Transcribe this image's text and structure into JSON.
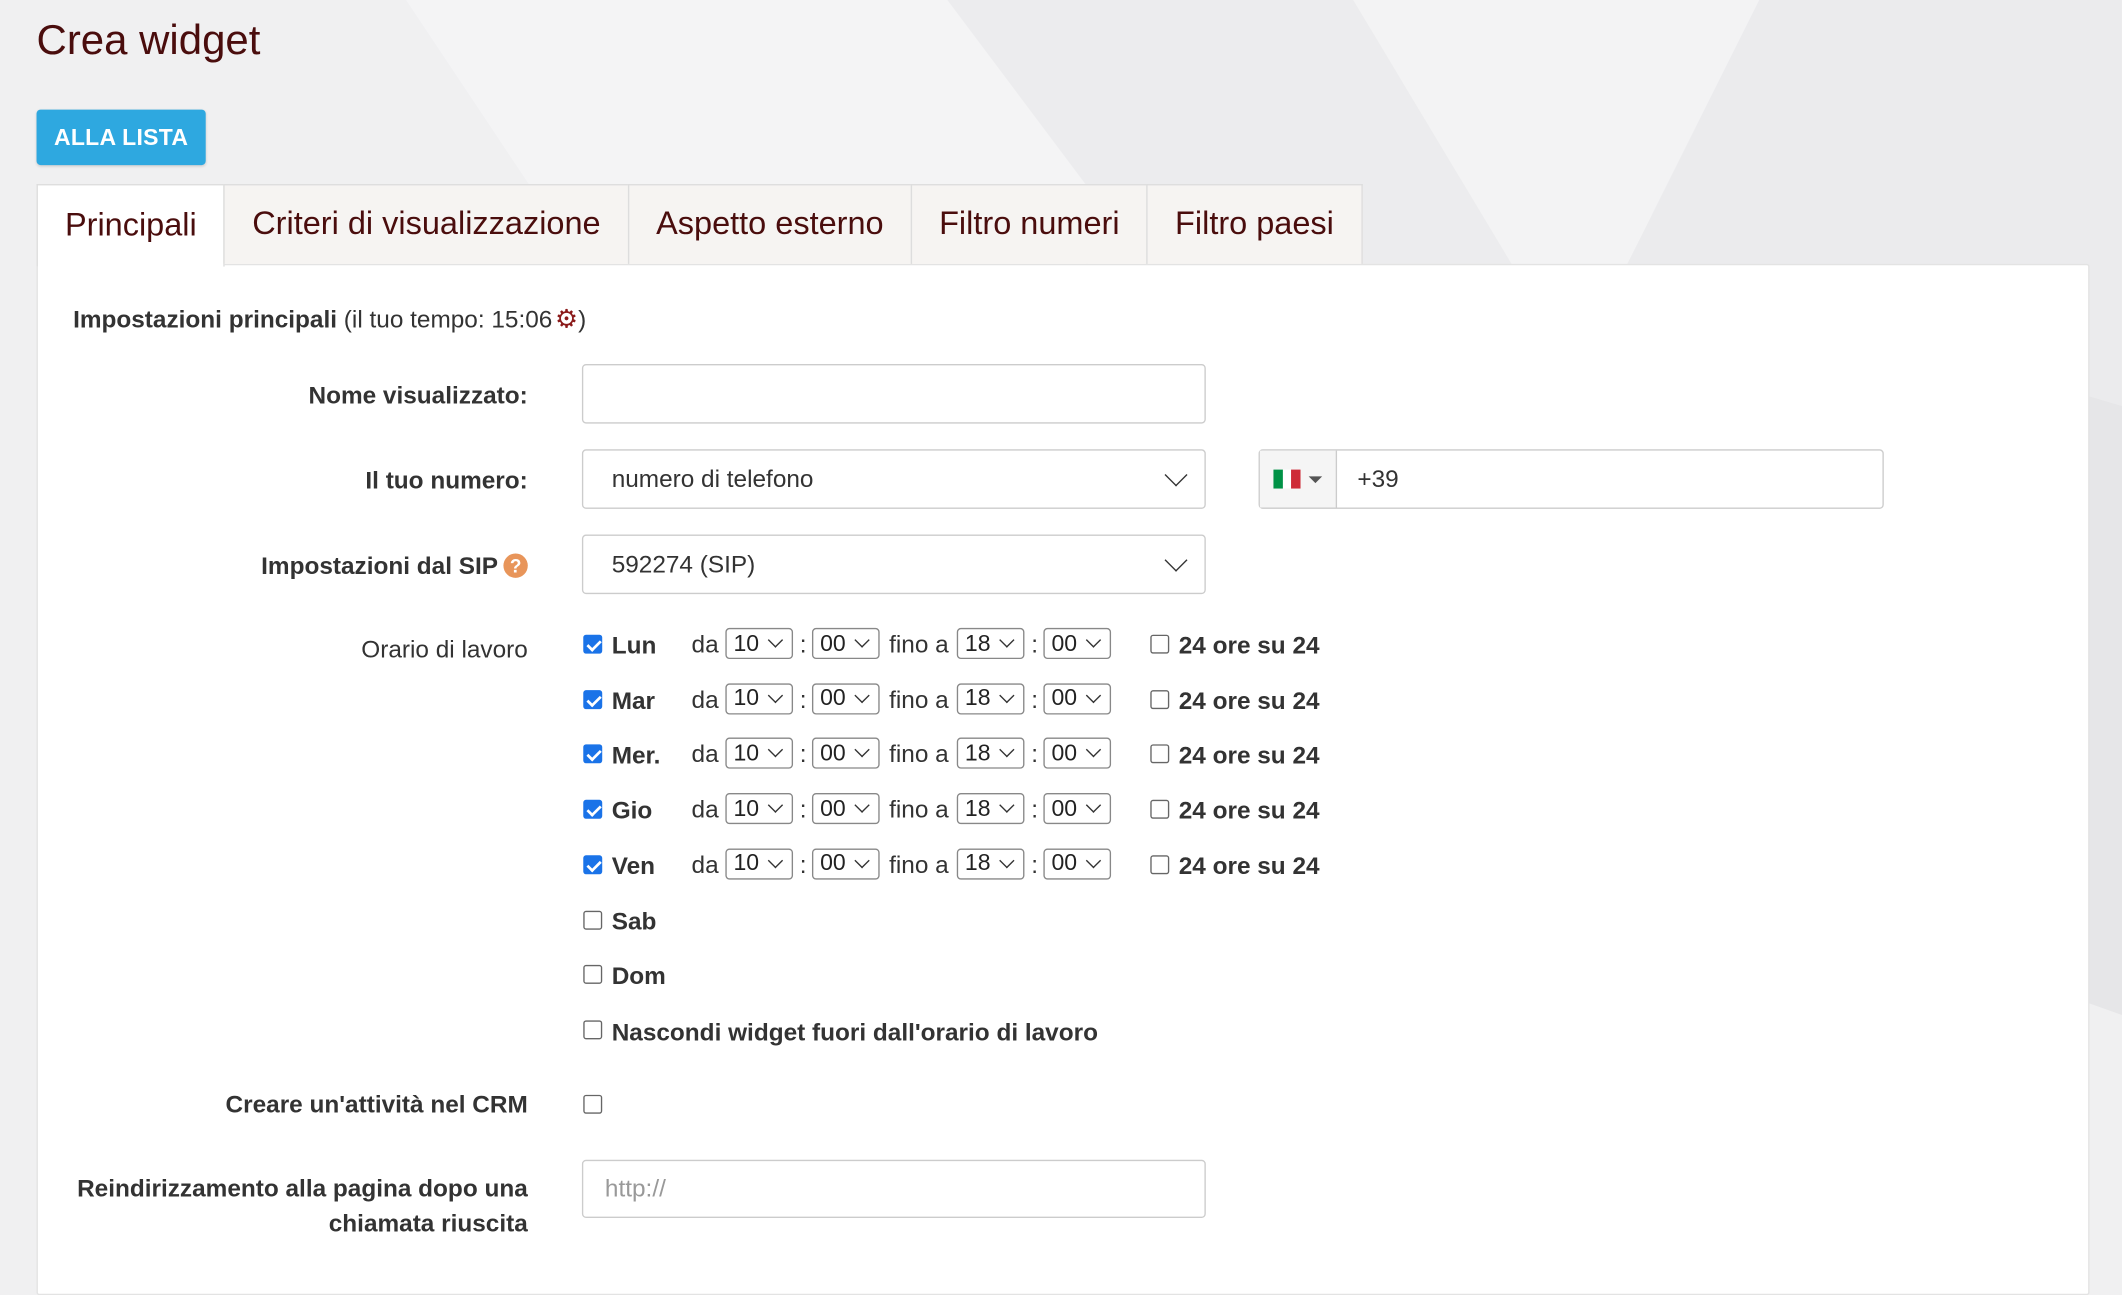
{
  "page": {
    "title": "Crea widget"
  },
  "toolbar": {
    "back_label": "ALLA LISTA"
  },
  "tabs": [
    {
      "label": "Principali",
      "active": true
    },
    {
      "label": "Criteri di visualizzazione",
      "active": false
    },
    {
      "label": "Aspetto esterno",
      "active": false
    },
    {
      "label": "Filtro numeri",
      "active": false
    },
    {
      "label": "Filtro paesi",
      "active": false
    }
  ],
  "section": {
    "title_bold": "Impostazioni principali",
    "time_prefix": "(il tuo tempo: 15:06",
    "time_suffix": ")"
  },
  "form": {
    "display_name": {
      "label": "Nome visualizzato:",
      "value": ""
    },
    "your_number": {
      "label": "Il tuo numero:",
      "selected": "numero di telefono"
    },
    "phone": {
      "country_icon": "italy-flag-icon",
      "value": "+39"
    },
    "sip": {
      "label": "Impostazioni dal SIP",
      "selected": "592274 (SIP)"
    },
    "working_hours": {
      "label": "Orario di lavoro",
      "from_label": "da",
      "to_label": "fino a",
      "separator": ":",
      "allday_label": "24 ore su 24",
      "days": [
        {
          "name": "Lun",
          "checked": true,
          "from_h": "10",
          "from_m": "00",
          "to_h": "18",
          "to_m": "00",
          "allday": false
        },
        {
          "name": "Mar",
          "checked": true,
          "from_h": "10",
          "from_m": "00",
          "to_h": "18",
          "to_m": "00",
          "allday": false
        },
        {
          "name": "Mer.",
          "checked": true,
          "from_h": "10",
          "from_m": "00",
          "to_h": "18",
          "to_m": "00",
          "allday": false
        },
        {
          "name": "Gio",
          "checked": true,
          "from_h": "10",
          "from_m": "00",
          "to_h": "18",
          "to_m": "00",
          "allday": false
        },
        {
          "name": "Ven",
          "checked": true,
          "from_h": "10",
          "from_m": "00",
          "to_h": "18",
          "to_m": "00",
          "allday": false
        },
        {
          "name": "Sab",
          "checked": false
        },
        {
          "name": "Dom",
          "checked": false
        }
      ],
      "hide_outside": {
        "label": "Nascondi widget fuori dall'orario di lavoro",
        "checked": false
      }
    },
    "crm": {
      "label": "Creare un'attività nel CRM",
      "checked": false
    },
    "redirect": {
      "label_line1": "Reindirizzamento alla pagina dopo una",
      "label_line2": "chiamata riuscita",
      "placeholder": "http://"
    }
  },
  "colors": {
    "accent": "#2ea8e0",
    "title": "#4a0d0d",
    "checkbox": "#1a73e8",
    "help": "#e8955a"
  }
}
